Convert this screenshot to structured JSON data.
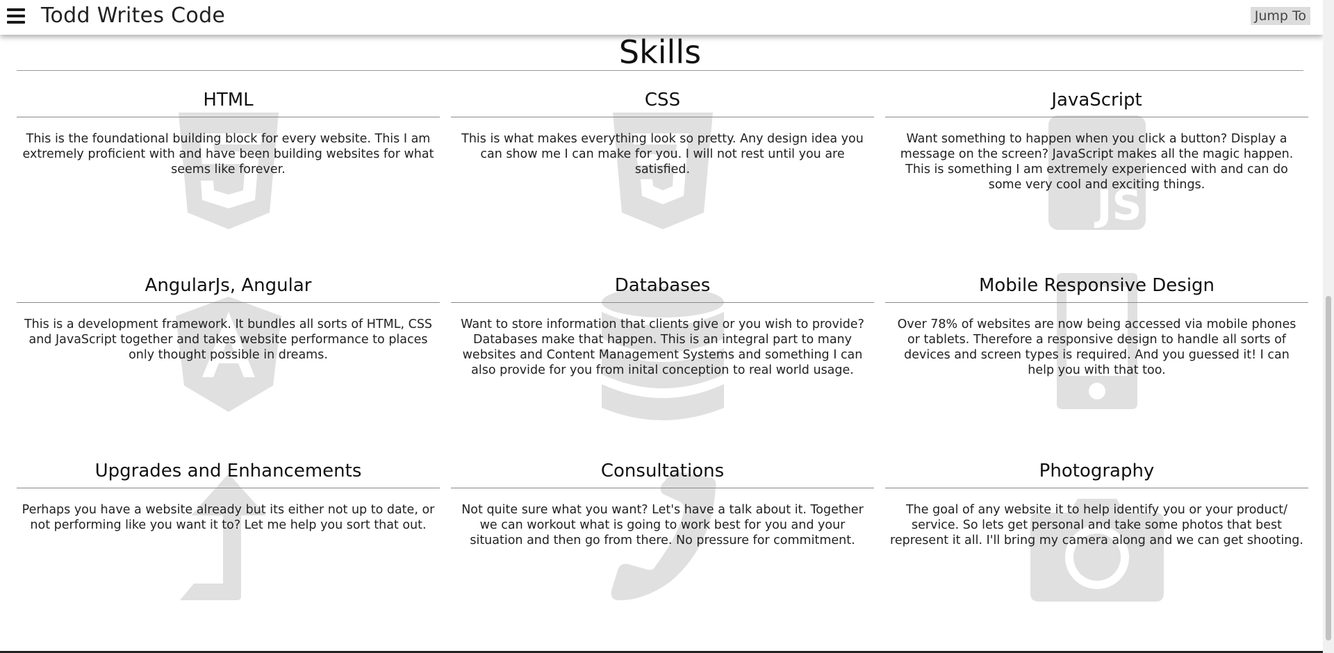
{
  "header": {
    "site_title": "Todd Writes Code",
    "jump_to_label": "Jump To"
  },
  "section": {
    "title": "Skills"
  },
  "colors": {
    "icon_fill": "#e0e0e0",
    "header_bg": "#ffffff",
    "jump_to_bg": "#dcdcdc"
  },
  "skills": [
    {
      "title": "HTML",
      "icon": "html5-icon",
      "text": "This is the foundational building block for every website. This I am extremely proficient with and have been building websites for what seems like forever."
    },
    {
      "title": "CSS",
      "icon": "css3-icon",
      "text": "This is what makes everything look so pretty. Any design idea you can show me I can make for you. I will not rest until you are satisfied."
    },
    {
      "title": "JavaScript",
      "icon": "javascript-icon",
      "text": "Want something to happen when you click a button? Display a message on the screen? JavaScript makes all the magic happen. This is something I am extremely experienced with and can do some very cool and exciting things."
    },
    {
      "title": "AngularJs, Angular",
      "icon": "angular-icon",
      "text": "This is a development framework. It bundles all sorts of HTML, CSS and JavaScript together and takes website performance to places only thought possible in dreams."
    },
    {
      "title": "Databases",
      "icon": "database-icon",
      "text": "Want to store information that clients give or you wish to provide? Databases make that happen. This is an integral part to many websites and Content Management Systems and something I can also provide for you from inital conception to real world usage."
    },
    {
      "title": "Mobile Responsive Design",
      "icon": "mobile-phone-icon",
      "text": "Over 78% of websites are now being accessed via mobile phones or tablets. Therefore a responsive design to handle all sorts of devices and screen types is required. And you guessed it! I can help you with that too."
    },
    {
      "title": "Upgrades and Enhancements",
      "icon": "level-up-arrow-icon",
      "text": "Perhaps you have a website already but its either not up to date, or not performing like you want it to? Let me help you sort that out."
    },
    {
      "title": "Consultations",
      "icon": "phone-icon",
      "text": "Not quite sure what you want? Let's have a talk about it. Together we can workout what is going to work best for you and your situation and then go from there. No pressure for commitment."
    },
    {
      "title": "Photography",
      "icon": "camera-icon",
      "text": "The goal of any website it to help identify you or your product/ service. So lets get personal and take some photos that best represent it all. I'll bring my camera along and we can get shooting."
    }
  ]
}
